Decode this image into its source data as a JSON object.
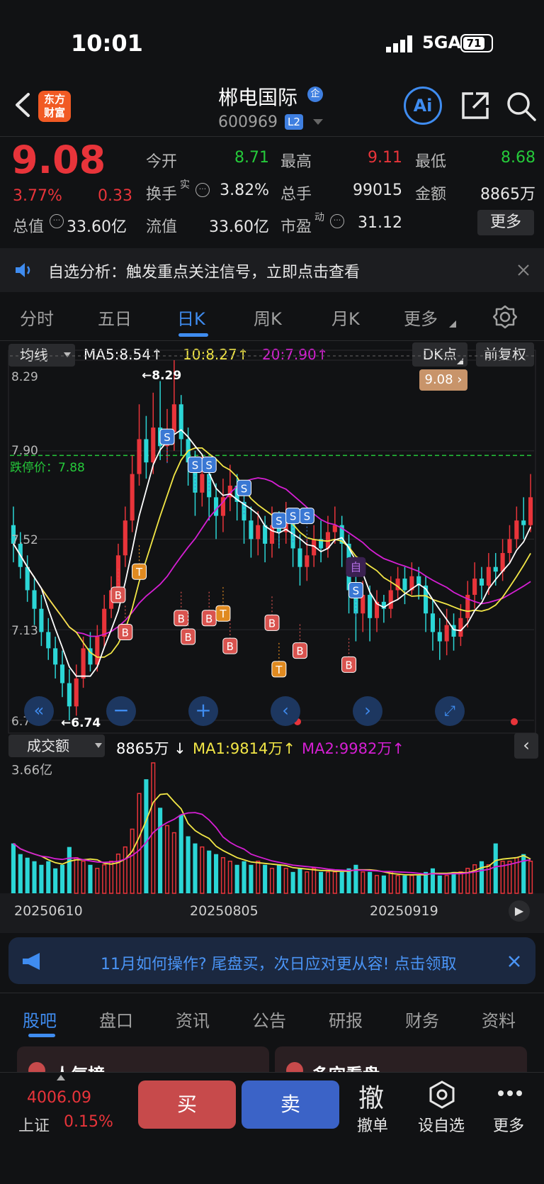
{
  "status_bar": {
    "time": "10:01",
    "network": "5GA",
    "battery": "71"
  },
  "header": {
    "name": "郴电国际",
    "badge": "企",
    "code": "600969",
    "level": "L2",
    "logo_line1": "东方",
    "logo_line2": "财富",
    "ai_label": "Ai"
  },
  "quote": {
    "price": "9.08",
    "change_pct": "3.77%",
    "change": "0.33",
    "open_label": "今开",
    "open": "8.71",
    "high_label": "最高",
    "high": "9.11",
    "low_label": "最低",
    "low": "8.68",
    "turnover_label": "换手",
    "turnover_sup": "实",
    "turnover": "3.82%",
    "volume_label": "总手",
    "volume": "99015",
    "amount_label": "金额",
    "amount": "8865万",
    "mcap_label": "总值",
    "mcap": "33.60亿",
    "float_label": "流值",
    "float": "33.60亿",
    "pe_label": "市盈",
    "pe_sup": "动",
    "pe": "31.12",
    "more": "更多"
  },
  "alert": {
    "text": "自选分析：触发重点关注信号，立即点击查看"
  },
  "kline_tabs": [
    "分时",
    "五日",
    "日K",
    "周K",
    "月K",
    "更多"
  ],
  "ma_row": {
    "selector": "均线",
    "ma5": "MA5:8.54",
    "ma10": "10:8.27",
    "ma20": "20:7.90",
    "dk": "DK点",
    "fq": "前复权"
  },
  "chart_data": {
    "type": "candlestick",
    "ylabels": [
      "8.29",
      "7.90",
      "7.52",
      "7.13",
      "6.74"
    ],
    "ylim": [
      6.74,
      8.29
    ],
    "limit_down_label": "跌停价：7.88",
    "limit_down_value": 7.88,
    "price_tag": "9.08",
    "max_marker": "←8.29",
    "min_marker": "←6.74",
    "colors": {
      "up": "#e8343a",
      "down": "#2bd6d6",
      "ma5": "#ffffff",
      "ma10": "#f2e646",
      "ma20": "#d51fd3"
    },
    "candles": [
      [
        7.58,
        7.5,
        7.66,
        7.42
      ],
      [
        7.5,
        7.4,
        7.55,
        7.35
      ],
      [
        7.4,
        7.3,
        7.45,
        7.25
      ],
      [
        7.3,
        7.22,
        7.36,
        7.15
      ],
      [
        7.22,
        7.12,
        7.28,
        7.06
      ],
      [
        7.12,
        7.05,
        7.18,
        7.0
      ],
      [
        7.05,
        6.98,
        7.1,
        6.92
      ],
      [
        6.98,
        6.9,
        7.04,
        6.84
      ],
      [
        6.9,
        6.8,
        6.96,
        6.74
      ],
      [
        6.8,
        6.92,
        6.98,
        6.76
      ],
      [
        6.92,
        7.05,
        7.1,
        6.88
      ],
      [
        7.05,
        6.98,
        7.12,
        6.95
      ],
      [
        6.98,
        7.1,
        7.15,
        6.95
      ],
      [
        7.1,
        7.22,
        7.28,
        7.05
      ],
      [
        7.22,
        7.3,
        7.36,
        7.18
      ],
      [
        7.3,
        7.45,
        7.5,
        7.25
      ],
      [
        7.45,
        7.6,
        7.66,
        7.4
      ],
      [
        7.6,
        7.8,
        7.88,
        7.55
      ],
      [
        7.8,
        7.95,
        8.1,
        7.75
      ],
      [
        7.95,
        7.85,
        8.05,
        7.78
      ],
      [
        7.85,
        8.0,
        8.15,
        7.8
      ],
      [
        8.0,
        7.92,
        8.2,
        7.86
      ],
      [
        7.92,
        7.98,
        8.08,
        7.85
      ],
      [
        7.98,
        8.1,
        8.29,
        7.9
      ],
      [
        8.1,
        7.95,
        8.14,
        7.88
      ],
      [
        7.95,
        7.85,
        8.0,
        7.75
      ],
      [
        7.85,
        7.72,
        7.9,
        7.62
      ],
      [
        7.72,
        7.8,
        7.88,
        7.66
      ],
      [
        7.8,
        7.7,
        7.85,
        7.6
      ],
      [
        7.7,
        7.62,
        7.76,
        7.52
      ],
      [
        7.62,
        7.7,
        7.78,
        7.55
      ],
      [
        7.7,
        7.75,
        7.84,
        7.64
      ],
      [
        7.75,
        7.68,
        7.8,
        7.6
      ],
      [
        7.68,
        7.6,
        7.74,
        7.5
      ],
      [
        7.6,
        7.52,
        7.66,
        7.44
      ],
      [
        7.52,
        7.58,
        7.64,
        7.45
      ],
      [
        7.58,
        7.5,
        7.62,
        7.42
      ],
      [
        7.5,
        7.58,
        7.66,
        7.44
      ],
      [
        7.58,
        7.55,
        7.64,
        7.48
      ],
      [
        7.55,
        7.6,
        7.68,
        7.5
      ],
      [
        7.6,
        7.48,
        7.64,
        7.4
      ],
      [
        7.48,
        7.4,
        7.54,
        7.32
      ],
      [
        7.4,
        7.45,
        7.52,
        7.34
      ],
      [
        7.45,
        7.52,
        7.58,
        7.4
      ],
      [
        7.52,
        7.48,
        7.6,
        7.42
      ],
      [
        7.48,
        7.55,
        7.62,
        7.44
      ],
      [
        7.55,
        7.58,
        7.66,
        7.5
      ],
      [
        7.58,
        7.5,
        7.62,
        7.4
      ],
      [
        7.5,
        7.3,
        7.54,
        7.2
      ],
      [
        7.3,
        7.2,
        7.36,
        7.08
      ],
      [
        7.2,
        7.28,
        7.34,
        7.12
      ],
      [
        7.28,
        7.18,
        7.32,
        7.08
      ],
      [
        7.18,
        7.25,
        7.3,
        7.12
      ],
      [
        7.25,
        7.22,
        7.28,
        7.16
      ],
      [
        7.22,
        7.3,
        7.36,
        7.18
      ],
      [
        7.3,
        7.35,
        7.4,
        7.26
      ],
      [
        7.35,
        7.3,
        7.4,
        7.24
      ],
      [
        7.3,
        7.36,
        7.42,
        7.28
      ],
      [
        7.36,
        7.32,
        7.4,
        7.26
      ],
      [
        7.32,
        7.2,
        7.36,
        7.12
      ],
      [
        7.2,
        7.12,
        7.26,
        7.04
      ],
      [
        7.12,
        7.08,
        7.18,
        7.0
      ],
      [
        7.08,
        7.15,
        7.22,
        7.02
      ],
      [
        7.15,
        7.1,
        7.2,
        7.04
      ],
      [
        7.1,
        7.18,
        7.24,
        7.06
      ],
      [
        7.18,
        7.28,
        7.34,
        7.14
      ],
      [
        7.28,
        7.35,
        7.42,
        7.22
      ],
      [
        7.35,
        7.32,
        7.4,
        7.26
      ],
      [
        7.32,
        7.4,
        7.46,
        7.28
      ],
      [
        7.4,
        7.38,
        7.46,
        7.32
      ],
      [
        7.38,
        7.46,
        7.52,
        7.34
      ],
      [
        7.46,
        7.52,
        7.58,
        7.42
      ],
      [
        7.52,
        7.6,
        7.66,
        7.48
      ],
      [
        7.6,
        7.58,
        7.7,
        7.52
      ],
      [
        7.58,
        7.7,
        7.8,
        7.55
      ]
    ],
    "buy_markers": [
      [
        15,
        7.28
      ],
      [
        16,
        7.12
      ],
      [
        24,
        7.18
      ],
      [
        25,
        7.1
      ],
      [
        28,
        7.18
      ],
      [
        31,
        7.06
      ],
      [
        37,
        7.16
      ],
      [
        41,
        7.04
      ],
      [
        48,
        6.98
      ]
    ],
    "sell_markers": [
      [
        22,
        7.96
      ],
      [
        26,
        7.84
      ],
      [
        28,
        7.84
      ],
      [
        33,
        7.74
      ],
      [
        38,
        7.6
      ],
      [
        40,
        7.62
      ],
      [
        42,
        7.62
      ],
      [
        49,
        7.3
      ]
    ],
    "t_markers": [
      [
        18,
        7.38
      ],
      [
        30,
        7.2
      ],
      [
        38,
        6.96
      ]
    ],
    "self_marker": [
      49,
      7.4
    ],
    "volume": {
      "label": "成交额",
      "value": "8865万",
      "ma1": "MA1:9814万",
      "ma2": "MA2:9982万",
      "ylabel": "3.66亿",
      "xlabels": [
        "20250610",
        "20250805",
        "20250919"
      ],
      "values": [
        1.4,
        1.1,
        1.0,
        0.9,
        0.8,
        0.9,
        0.7,
        0.8,
        1.3,
        1.0,
        0.9,
        0.8,
        0.7,
        0.8,
        0.9,
        1.1,
        1.3,
        1.8,
        2.8,
        3.2,
        3.66,
        2.4,
        1.9,
        1.7,
        2.2,
        1.6,
        1.4,
        1.3,
        1.2,
        1.1,
        1.0,
        0.9,
        0.8,
        0.9,
        0.8,
        0.9,
        0.8,
        0.7,
        0.8,
        0.7,
        0.6,
        0.7,
        0.6,
        0.7,
        0.6,
        0.6,
        0.6,
        0.6,
        0.7,
        0.8,
        0.6,
        0.6,
        0.5,
        0.5,
        0.6,
        0.5,
        0.5,
        0.5,
        0.5,
        0.6,
        0.7,
        0.5,
        0.5,
        0.6,
        0.6,
        0.7,
        0.8,
        0.9,
        0.8,
        1.4,
        0.9,
        0.9,
        1.0,
        1.1,
        0.9
      ]
    }
  },
  "banner": {
    "text": "11月如何操作? 尾盘买，次日应对更从容! 点击领取"
  },
  "bottom_tabs": [
    "股吧",
    "盘口",
    "资讯",
    "公告",
    "研报",
    "财务",
    "资料"
  ],
  "sub_cards": [
    "人气榜",
    "多空看盘"
  ],
  "footer": {
    "index_value": "4006.09",
    "index_name": "上证",
    "index_pct": "0.15%",
    "buy": "买",
    "sell": "卖",
    "cancel_glyph": "撤",
    "cancel": "撤单",
    "watch": "设自选",
    "more": "更多"
  }
}
